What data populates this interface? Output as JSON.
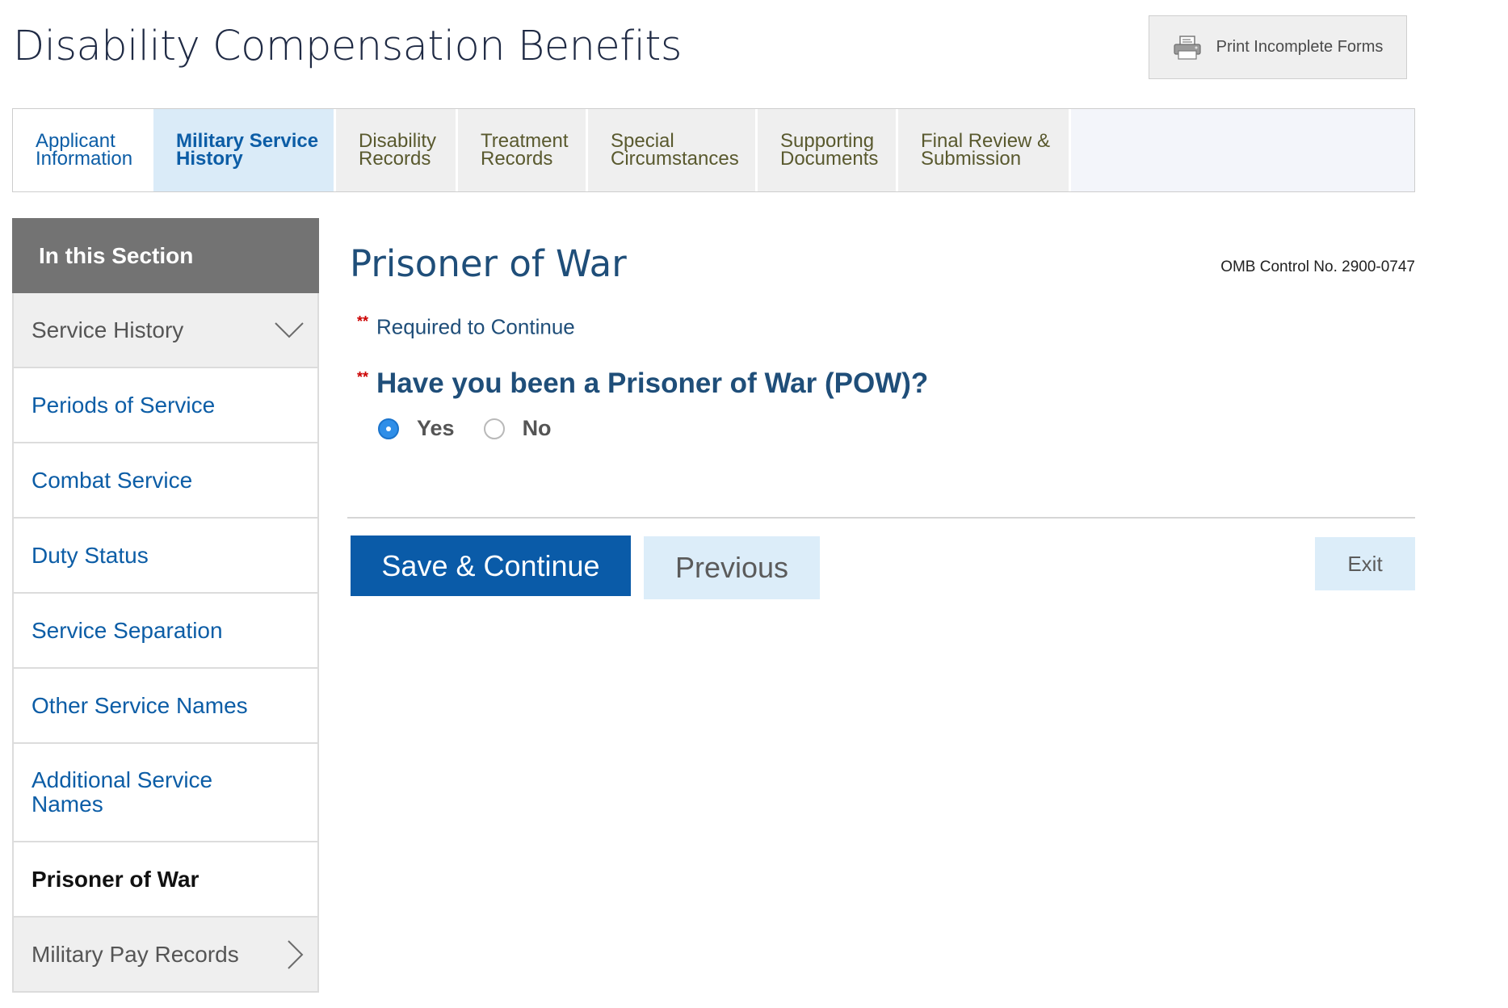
{
  "header": {
    "title": "Disability Compensation Benefits",
    "print_label": "Print Incomplete Forms"
  },
  "tabs": [
    {
      "label": "Applicant\nInformation",
      "state": "done"
    },
    {
      "label": "Military Service\nHistory",
      "state": "current"
    },
    {
      "label": "Disability\nRecords",
      "state": "upcoming"
    },
    {
      "label": "Treatment\nRecords",
      "state": "upcoming"
    },
    {
      "label": "Special\nCircumstances",
      "state": "upcoming"
    },
    {
      "label": "Supporting\nDocuments",
      "state": "upcoming"
    },
    {
      "label": "Final Review &\nSubmission",
      "state": "upcoming"
    }
  ],
  "sidebar": {
    "heading": "In this Section",
    "items": [
      {
        "label": "Service History"
      },
      {
        "label": "Periods of Service"
      },
      {
        "label": "Combat Service"
      },
      {
        "label": "Duty Status"
      },
      {
        "label": "Service Separation"
      },
      {
        "label": "Other Service Names"
      },
      {
        "label": "Additional Service Names"
      },
      {
        "label": "Prisoner of War"
      },
      {
        "label": "Military Pay Records"
      }
    ]
  },
  "main": {
    "title": "Prisoner of War",
    "omb": "OMB Control No. 2900-0747",
    "required_marker": "**",
    "required_text": "Required to Continue",
    "question": "Have you been a Prisoner of War (POW)?",
    "options": [
      {
        "label": "Yes",
        "selected": true
      },
      {
        "label": "No",
        "selected": false
      }
    ]
  },
  "actions": {
    "save": "Save & Continue",
    "previous": "Previous",
    "exit": "Exit"
  },
  "colors": {
    "primary": "#0a5ba8",
    "link": "#0c5da6",
    "heading": "#1f4e79",
    "required": "#cc0000",
    "light_button": "#dcedf9"
  }
}
